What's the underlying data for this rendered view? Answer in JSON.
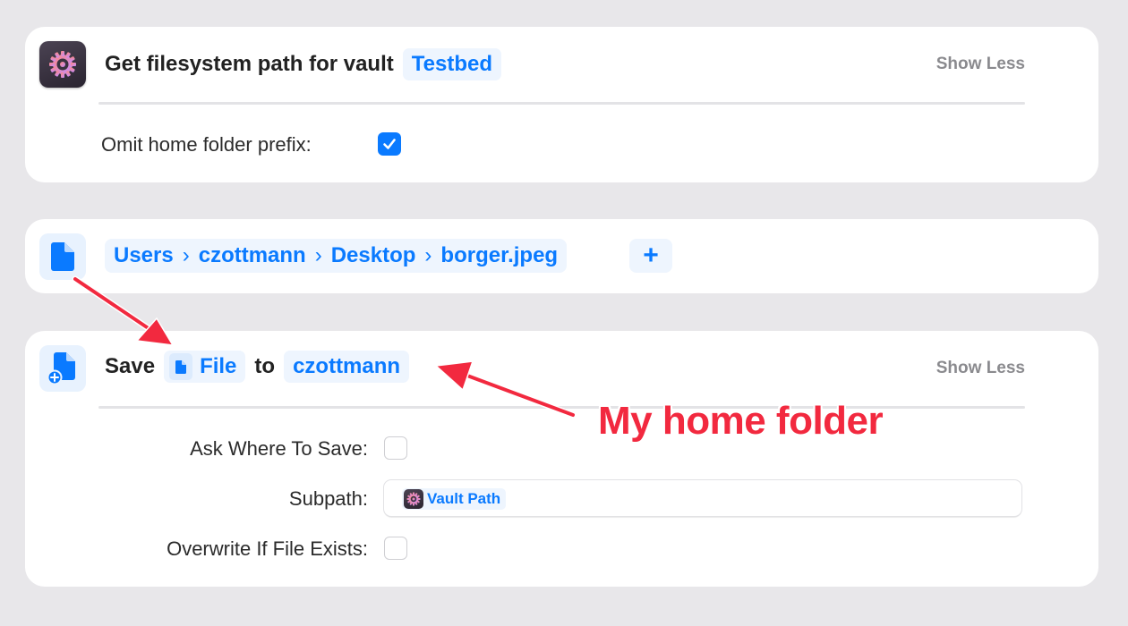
{
  "action1": {
    "title": "Get filesystem path for vault",
    "vault_token": "Testbed",
    "show_less": "Show Less",
    "omit_label": "Omit home folder prefix:",
    "omit_checked": true,
    "icon": "gear-app-icon"
  },
  "action2": {
    "icon": "file-icon",
    "path": [
      "Users",
      "czottmann",
      "Desktop",
      "borger.jpeg"
    ],
    "separator": "›",
    "add_label": "+"
  },
  "action3": {
    "icon": "save-file-icon",
    "verb": "Save",
    "file_token": "File",
    "to": "to",
    "destination_token": "czottmann",
    "show_less": "Show Less",
    "ask_label": "Ask Where To Save:",
    "ask_checked": false,
    "subpath_label": "Subpath:",
    "subpath_token": "Vault Path",
    "overwrite_label": "Overwrite If File Exists:",
    "overwrite_checked": false
  },
  "annotation": {
    "text": "My home folder",
    "color": "#f2293f"
  },
  "colors": {
    "accent": "#0a7aff",
    "token_bg": "#eef5fe",
    "background": "#e8e7ea"
  }
}
